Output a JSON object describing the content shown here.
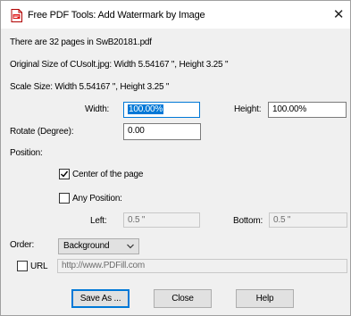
{
  "window": {
    "title": "Free PDF Tools: Add Watermark by Image",
    "close_glyph": "✕",
    "icon": "pdf-file-icon"
  },
  "info": {
    "pages_line": "There are 32 pages in SwB20181.pdf",
    "original_size_line": "Original Size of CUsolt.jpg:  Width 5.54167 \",   Height 3.25 \"",
    "scale_size_line": "Scale Size:  Width 5.54167 \",   Height 3.25 \""
  },
  "scale": {
    "width_label": "Width:",
    "width_value": "100.00%",
    "height_label": "Height:",
    "height_value": "100.00%"
  },
  "rotate": {
    "label": "Rotate (Degree):",
    "value": "0.00"
  },
  "position": {
    "label": "Position:",
    "center_label": "Center of the page",
    "center_checked": true,
    "any_label": "Any Position:",
    "any_checked": false,
    "left_label": "Left:",
    "left_value": "0.5 \"",
    "bottom_label": "Bottom:",
    "bottom_value": "0.5 \""
  },
  "order": {
    "label": "Order:",
    "selected": "Background"
  },
  "url": {
    "label": "URL",
    "checked": false,
    "value": "http://www.PDFill.com"
  },
  "buttons": {
    "save_as": "Save As ...",
    "close": "Close",
    "help": "Help"
  }
}
